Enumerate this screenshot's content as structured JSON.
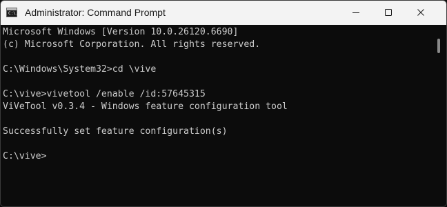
{
  "window": {
    "title": "Administrator: Command Prompt",
    "app_icon": "command-prompt-icon",
    "app_icon_glyph": "C:\\.",
    "controls": {
      "minimize_icon": "minimize-icon",
      "maximize_icon": "maximize-icon",
      "close_icon": "close-icon"
    }
  },
  "console": {
    "lines": [
      "Microsoft Windows [Version 10.0.26120.6690]",
      "(c) Microsoft Corporation. All rights reserved.",
      "",
      "C:\\Windows\\System32>cd \\vive",
      "",
      "C:\\vive>vivetool /enable /id:57645315",
      "ViVeTool v0.3.4 - Windows feature configuration tool",
      "",
      "Successfully set feature configuration(s)",
      "",
      "C:\\vive>"
    ]
  },
  "colors": {
    "console_background": "#0c0c0c",
    "console_text": "#cccccc",
    "titlebar_background": "#f3f3f3"
  }
}
